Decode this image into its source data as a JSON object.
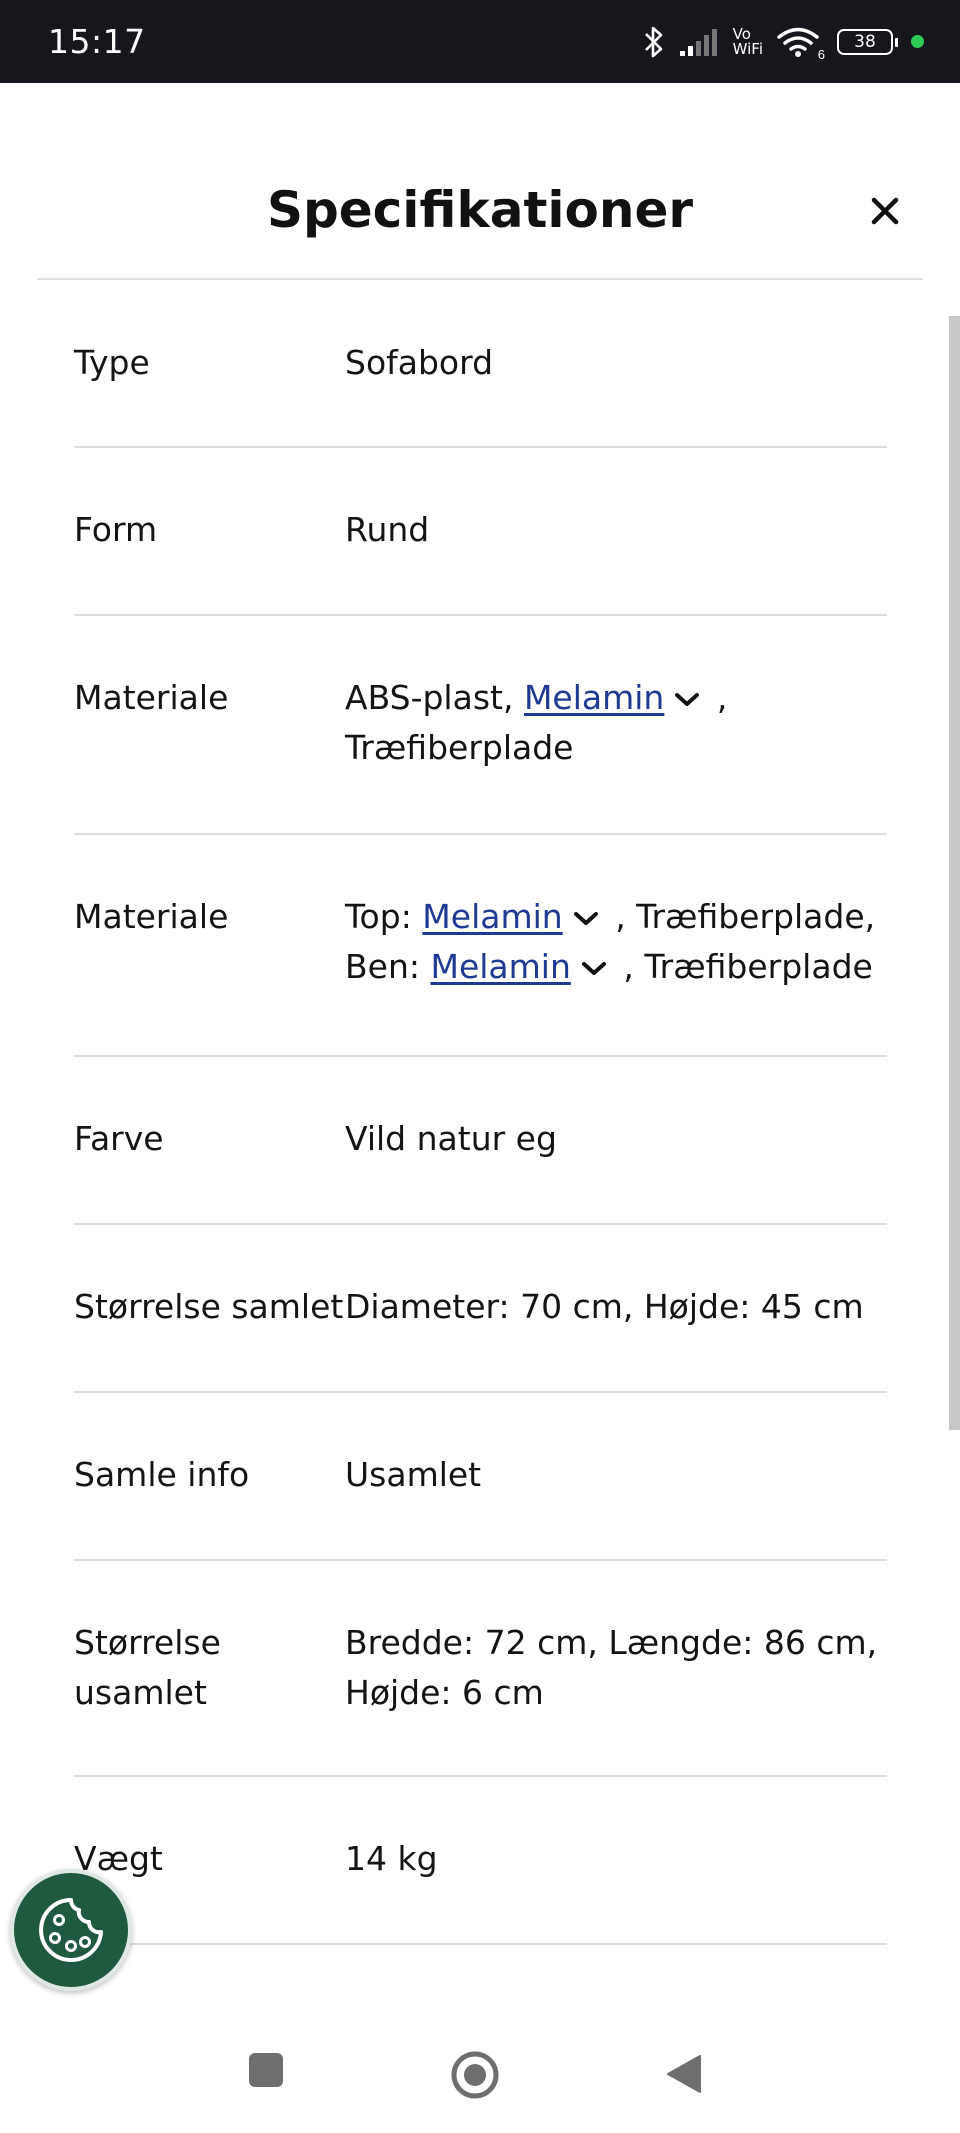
{
  "status_bar": {
    "time": "15:17",
    "vowifi_top": "Vo",
    "vowifi_bottom": "WiFi",
    "battery": "38",
    "wifi_badge": "6",
    "dot_color": "#2ecc55",
    "icons": [
      "bluetooth-icon",
      "signal-icon",
      "vowifi-icon",
      "wifi-icon",
      "battery-icon"
    ]
  },
  "header": {
    "title": "Specifikationer",
    "close_icon": "close-icon"
  },
  "specs": [
    {
      "label": "Type",
      "value": "Sofabord"
    },
    {
      "label": "Form",
      "value": "Rund"
    },
    {
      "label": "Materiale",
      "value_parts": [
        "ABS-plast, ",
        "Melamin",
        " ,",
        "Træfiberplade"
      ]
    },
    {
      "label": "Materiale",
      "value_parts": [
        "Top: ",
        "Melamin",
        " , Træfiberplade,",
        "Ben: ",
        "Melamin",
        " , Træfiberplade"
      ]
    },
    {
      "label": "Farve",
      "value": "Vild natur eg"
    },
    {
      "label": "Størrelse samlet",
      "value": "Diameter: 70 cm, Højde: 45 cm"
    },
    {
      "label": "Samle info",
      "value": "Usamlet"
    },
    {
      "label_lines": [
        "Størrelse",
        "usamlet"
      ],
      "value_lines": [
        "Bredde: 72 cm, Længde: 86 cm,",
        "Højde: 6 cm"
      ]
    },
    {
      "label": "Vægt",
      "value": "14 kg"
    }
  ],
  "colors": {
    "link": "#1f3a93",
    "cookie_button": "#1f5a3f",
    "status_bar": "#16171c"
  },
  "cookie_button": {
    "icon": "cookie-icon"
  },
  "nav_bar": {
    "icons": [
      "recents-square-icon",
      "home-circle-icon",
      "back-triangle-icon"
    ]
  }
}
